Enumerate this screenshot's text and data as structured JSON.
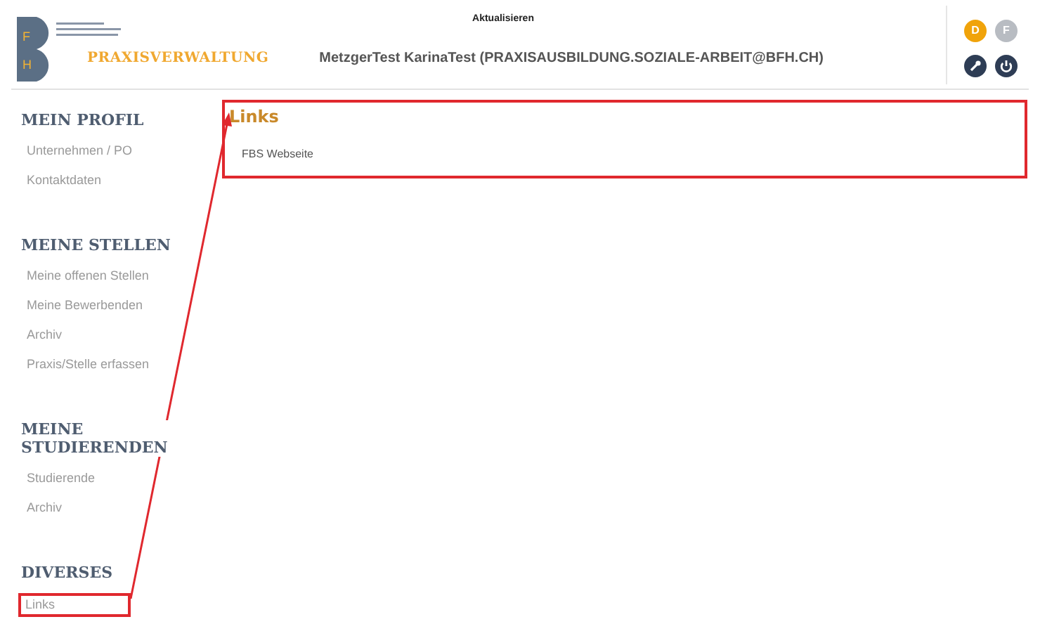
{
  "header": {
    "logo_letters": [
      "F",
      "H"
    ],
    "refresh": "Aktualisieren",
    "app_title": "PRAXISVERWALTUNG",
    "user": "MetzgerTest KarinaTest (PRAXISAUSBILDUNG.SOZIALE-ARBEIT@BFH.CH)",
    "languages": [
      {
        "label": "D",
        "selected": true
      },
      {
        "label": "F",
        "selected": false
      }
    ]
  },
  "sidebar": [
    {
      "heading": "MEIN PROFIL",
      "items": [
        {
          "label": "Unternehmen / PO",
          "highlighted": false
        },
        {
          "label": "Kontaktdaten",
          "highlighted": false
        }
      ]
    },
    {
      "heading": "MEINE STELLEN",
      "items": [
        {
          "label": "Meine offenen Stellen",
          "highlighted": false
        },
        {
          "label": "Meine Bewerbenden",
          "highlighted": false
        },
        {
          "label": "Archiv",
          "highlighted": false
        },
        {
          "label": "Praxis/Stelle erfassen",
          "highlighted": false
        }
      ]
    },
    {
      "heading": "MEINE STUDIERENDEN",
      "items": [
        {
          "label": "Studierende",
          "highlighted": false
        },
        {
          "label": "Archiv",
          "highlighted": false
        }
      ]
    },
    {
      "heading": "DIVERSES",
      "items": [
        {
          "label": "Links",
          "highlighted": true
        }
      ]
    }
  ],
  "panel": {
    "title": "Links",
    "highlighted": true,
    "links": [
      "FBS Webseite"
    ]
  }
}
